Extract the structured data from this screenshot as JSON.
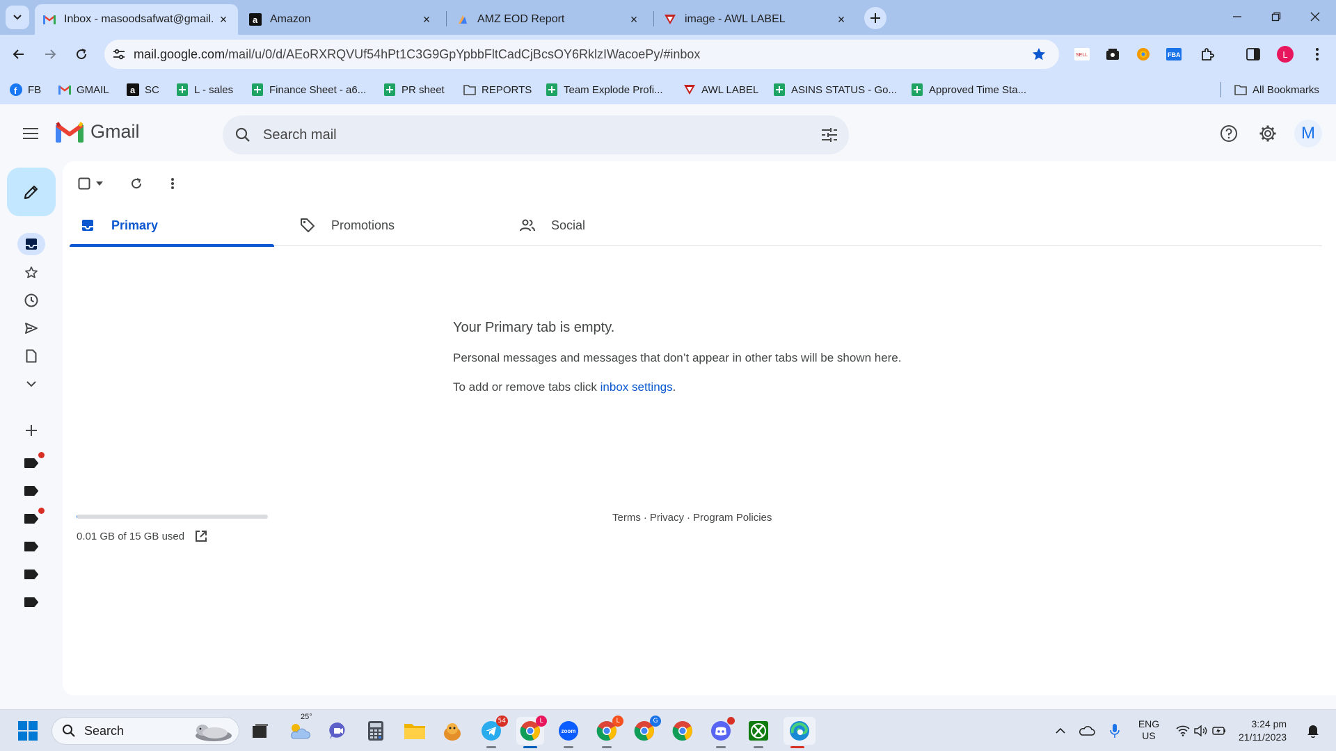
{
  "browser": {
    "tabs": [
      {
        "title": "Inbox - masoodsafwat@gmail.",
        "icon": "gmail-icon",
        "active": true
      },
      {
        "title": "Amazon",
        "icon": "amazon-icon",
        "active": false
      },
      {
        "title": "AMZ EOD Report",
        "icon": "report-icon",
        "active": false
      },
      {
        "title": "image - AWL LABEL",
        "icon": "awl-icon",
        "active": false
      }
    ],
    "url_host": "mail.google.com",
    "url_path": "/mail/u/0/d/AEoRXRQVUf54hPt1C3G9GpYpbbFltCadCjBcsOY6RklzIWacoePy/#inbox",
    "profile_initial": "L",
    "bookmarks": [
      {
        "label": "FB"
      },
      {
        "label": "GMAIL"
      },
      {
        "label": "SC"
      },
      {
        "label": "L - sales"
      },
      {
        "label": "Finance Sheet - a6..."
      },
      {
        "label": "PR sheet"
      },
      {
        "label": "REPORTS"
      },
      {
        "label": "Team Explode Profi..."
      },
      {
        "label": "AWL LABEL"
      },
      {
        "label": "ASINS STATUS - Go..."
      },
      {
        "label": "Approved Time Sta..."
      }
    ],
    "all_bookmarks": "All Bookmarks"
  },
  "gmail": {
    "app_name": "Gmail",
    "search_placeholder": "Search mail",
    "account_initial": "M",
    "category_tabs": [
      {
        "label": "Primary",
        "active": true
      },
      {
        "label": "Promotions",
        "active": false
      },
      {
        "label": "Social",
        "active": false
      }
    ],
    "empty_state": {
      "heading": "Your Primary tab is empty.",
      "line1": "Personal messages and messages that don’t appear in other tabs will be shown here.",
      "line2_prefix": "To add or remove tabs click ",
      "line2_link": "inbox settings",
      "line2_suffix": "."
    },
    "storage": {
      "text": "0.01 GB of 15 GB used",
      "fraction_used": 0.0007
    },
    "footer": {
      "terms": "Terms",
      "privacy": "Privacy",
      "policies": "Program Policies",
      "separator": "·"
    }
  },
  "taskbar": {
    "search_label": "Search",
    "weather_temp": "25°",
    "telegram_badge": "54",
    "chrome_badge": "L",
    "chrome2_badge": "L",
    "chrome3_badge": "G",
    "language_top": "ENG",
    "language_bottom": "US",
    "time": "3:24 pm",
    "date": "21/11/2023"
  },
  "colors": {
    "accent": "#0b57d0",
    "compose_bg": "#c2e7ff",
    "tabstrip_bg": "#a8c4ec",
    "toolbar_bg": "#d3e3fd",
    "profile_red": "#e8175d"
  }
}
